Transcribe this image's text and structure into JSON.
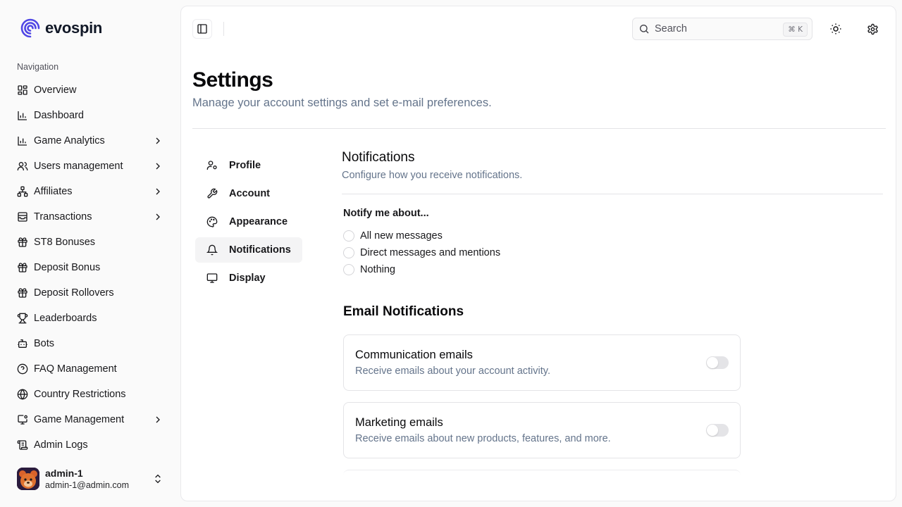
{
  "brand": {
    "name": "evospin",
    "logo_icon": "spiral-logo-icon",
    "color": "#4f46e5"
  },
  "sidebar": {
    "section_label": "Navigation",
    "items": [
      {
        "label": "Overview",
        "icon": "layout-grid-icon",
        "has_children": false
      },
      {
        "label": "Dashboard",
        "icon": "bar-chart-icon",
        "has_children": false
      },
      {
        "label": "Game Analytics",
        "icon": "bar-chart-icon",
        "has_children": true
      },
      {
        "label": "Users management",
        "icon": "users-icon",
        "has_children": true
      },
      {
        "label": "Affiliates",
        "icon": "network-icon",
        "has_children": true
      },
      {
        "label": "Transactions",
        "icon": "archive-icon",
        "has_children": true
      },
      {
        "label": "ST8 Bonuses",
        "icon": "gift-icon",
        "has_children": false
      },
      {
        "label": "Deposit Bonus",
        "icon": "gift-icon",
        "has_children": false
      },
      {
        "label": "Deposit Rollovers",
        "icon": "gift-icon",
        "has_children": false
      },
      {
        "label": "Leaderboards",
        "icon": "trophy-icon",
        "has_children": false
      },
      {
        "label": "Bots",
        "icon": "bot-icon",
        "has_children": false
      },
      {
        "label": "FAQ Management",
        "icon": "help-circle-icon",
        "has_children": false
      },
      {
        "label": "Country Restrictions",
        "icon": "globe-icon",
        "has_children": false
      },
      {
        "label": "Game Management",
        "icon": "monitor-settings-icon",
        "has_children": true
      },
      {
        "label": "Admin Logs",
        "icon": "scroll-icon",
        "has_children": false
      }
    ],
    "user": {
      "name": "admin-1",
      "email": "admin-1@admin.com"
    }
  },
  "topbar": {
    "search_placeholder": "Search",
    "search_shortcut": "⌘ K"
  },
  "page": {
    "title": "Settings",
    "subtitle": "Manage your account settings and set e-mail preferences."
  },
  "settings_nav": [
    {
      "label": "Profile",
      "icon": "user-cog-icon",
      "active": false
    },
    {
      "label": "Account",
      "icon": "wrench-icon",
      "active": false
    },
    {
      "label": "Appearance",
      "icon": "palette-icon",
      "active": false
    },
    {
      "label": "Notifications",
      "icon": "bell-icon",
      "active": true
    },
    {
      "label": "Display",
      "icon": "monitor-icon",
      "active": false
    }
  ],
  "notifications": {
    "title": "Notifications",
    "subtitle": "Configure how you receive notifications.",
    "notify_label": "Notify me about...",
    "options": [
      "All new messages",
      "Direct messages and mentions",
      "Nothing"
    ],
    "email_section_title": "Email Notifications",
    "email_cards": [
      {
        "title": "Communication emails",
        "description": "Receive emails about your account activity.",
        "enabled": false
      },
      {
        "title": "Marketing emails",
        "description": "Receive emails about new products, features, and more.",
        "enabled": false
      }
    ]
  }
}
